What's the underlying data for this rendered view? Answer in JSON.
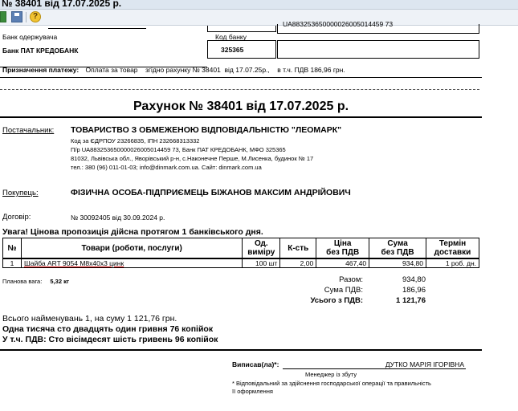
{
  "window": {
    "title": "№ 38401 від 17.07.2025 р."
  },
  "toolbar": {
    "help_glyph": "?"
  },
  "bank": {
    "recipient_bank_label": "Банк одержувача",
    "bank_code_label": "Код банку",
    "bank_name": "Банк ПАТ КРЕДОБАНК",
    "bank_code": "325365",
    "account_partial": "UA883253650000026005014459 73"
  },
  "purpose": {
    "label": "Призначення платежу:",
    "text": "Оплата за товар    згідно рахунку № 38401  від 17.07.25р.,    в т.ч. ПДВ 186,96 грн."
  },
  "invoice": {
    "title": "Рахунок № 38401 від 17.07.2025 р."
  },
  "supplier": {
    "label": "Постачальник:",
    "name": "ТОВАРИСТВО З ОБМЕЖЕНОЮ ВІДПОВІДАЛЬНІСТЮ \"ЛЕОМАРК\"",
    "line1": "Код за ЄДРПОУ 23266835, ІПН 232668313332",
    "line2": "П/р UA883253650000026005014459 73, Банк ПАТ КРЕДОБАНК, МФО 325365",
    "line3": "81032, Львівська обл., Яворівський р-н, с.Наконечне Перше, М.Лисенка, будинок № 17",
    "line4": "тел.: 380 (96) 011-01-03; info@dinmark.com.ua. Сайт: dinmark.com.ua"
  },
  "buyer": {
    "label": "Покупець:",
    "name": "ФІЗИЧНА ОСОБА-ПІДПРИЄМЕЦЬ БІЖАНОВ МАКСИМ АНДРІЙОВИЧ"
  },
  "contract": {
    "label": "Договір:",
    "value": "№ 30092405 від 30.09.2024 р."
  },
  "notice": "Увага! Цінова пропозиція дійсна протягом 1 банківського дня.",
  "table": {
    "headers": {
      "num": "№",
      "name": "Товари (роботи, послуги)",
      "unit1": "Од.",
      "unit2": "виміру",
      "qty": "К-сть",
      "price1": "Ціна",
      "price2": "без ПДВ",
      "sum1": "Сума",
      "sum2": "без ПДВ",
      "term1": "Термін",
      "term2": "доставки"
    },
    "rows": [
      {
        "num": "1",
        "name": "Шайба ART 9054 M8x40x3 цинк",
        "unit": "100 шт",
        "qty": "2,00",
        "price": "467,40",
        "sum": "934,80",
        "term": "1 роб. дн."
      }
    ]
  },
  "weight": {
    "label": "Планова вага:",
    "value": "5,32 кг"
  },
  "totals": {
    "total_label": "Разом:",
    "total_value": "934,80",
    "vat_label": "Сума ПДВ:",
    "vat_value": "186,96",
    "grand_label": "Усього з ПДВ:",
    "grand_value": "1 121,76"
  },
  "summary": {
    "line1": "Всього найменувань 1, на суму 1 121,76 грн.",
    "line2": "Одна тисяча сто двадцять один гривня 76 копійок",
    "line3": "У т.ч. ПДВ: Сто вісімдесят шість гривень 96 копійок"
  },
  "signature": {
    "label": "Виписав(ла)*:",
    "name": "ДУТКО МАРІЯ ІГОРІВНА",
    "position": "Менеджер із збуту",
    "note1": "* Відповідальний за здійснення господарської операції та правильність",
    "note2": "її оформлення"
  }
}
